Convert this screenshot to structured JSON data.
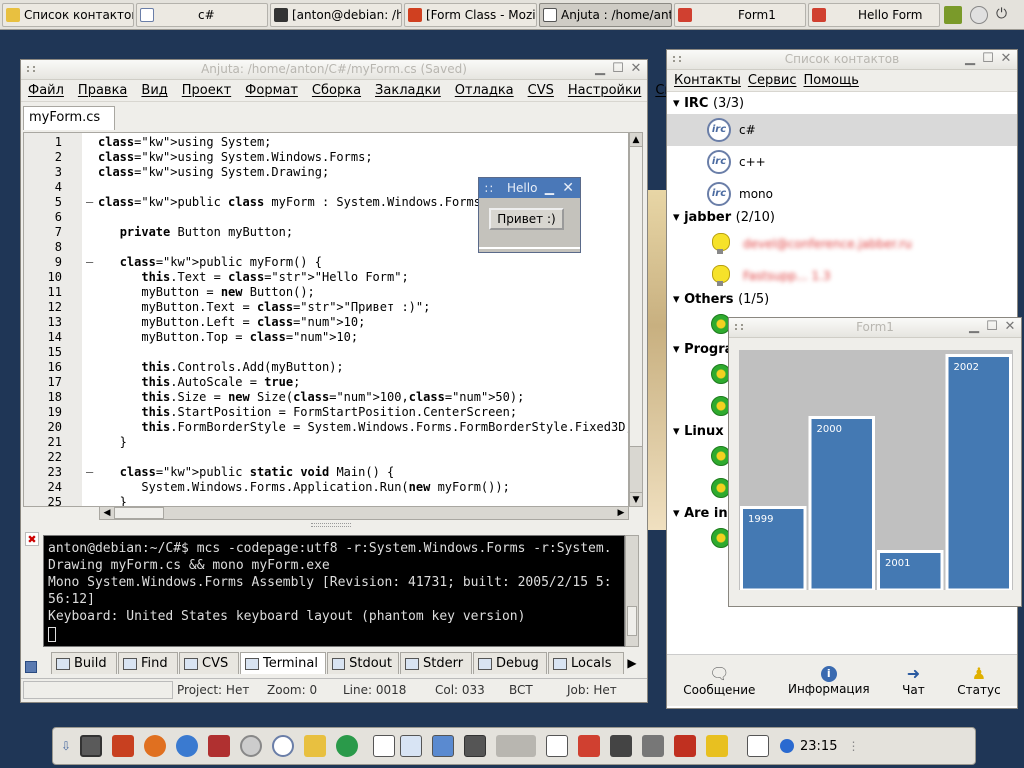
{
  "taskbar": {
    "tasks": [
      "Список контактов",
      "c#",
      "[anton@debian: /ho",
      "[Form Class - Mozil",
      "Anjuta : /home/ant",
      "Form1",
      "Hello Form"
    ]
  },
  "anjuta": {
    "title": "Anjuta: /home/anton/C#/myForm.cs (Saved)",
    "menu": [
      "Файл",
      "Правка",
      "Вид",
      "Проект",
      "Формат",
      "Сборка",
      "Закладки",
      "Отладка",
      "CVS",
      "Настройки",
      "Справка"
    ],
    "file_tab": "myForm.cs",
    "code_lines": [
      {
        "n": "1",
        "t": "using System;"
      },
      {
        "n": "2",
        "t": "using System.Windows.Forms;"
      },
      {
        "n": "3",
        "t": "using System.Drawing;"
      },
      {
        "n": "4",
        "t": ""
      },
      {
        "n": "5",
        "t": "public class myForm : System.Windows.Forms.Form {"
      },
      {
        "n": "6",
        "t": ""
      },
      {
        "n": "7",
        "t": "   private Button myButton;"
      },
      {
        "n": "8",
        "t": ""
      },
      {
        "n": "9",
        "t": "   public myForm() {"
      },
      {
        "n": "10",
        "t": "      this.Text = \"Hello Form\";"
      },
      {
        "n": "11",
        "t": "      myButton = new Button();"
      },
      {
        "n": "12",
        "t": "      myButton.Text = \"Привет :)\";"
      },
      {
        "n": "13",
        "t": "      myButton.Left = 10;"
      },
      {
        "n": "14",
        "t": "      myButton.Top = 10;"
      },
      {
        "n": "15",
        "t": ""
      },
      {
        "n": "16",
        "t": "      this.Controls.Add(myButton);"
      },
      {
        "n": "17",
        "t": "      this.AutoScale = true;"
      },
      {
        "n": "18",
        "t": "      this.Size = new Size(100,50);"
      },
      {
        "n": "19",
        "t": "      this.StartPosition = FormStartPosition.CenterScreen;"
      },
      {
        "n": "20",
        "t": "      this.FormBorderStyle = System.Windows.Forms.FormBorderStyle.Fixed3D;"
      },
      {
        "n": "21",
        "t": "   }"
      },
      {
        "n": "22",
        "t": ""
      },
      {
        "n": "23",
        "t": "   public static void Main() {"
      },
      {
        "n": "24",
        "t": "      System.Windows.Forms.Application.Run(new myForm());"
      },
      {
        "n": "25",
        "t": "   }"
      }
    ],
    "terminal_lines": [
      "anton@debian:~/C#$ mcs -codepage:utf8 -r:System.Windows.Forms -r:System.",
      "Drawing myForm.cs && mono myForm.exe",
      "Mono System.Windows.Forms Assembly [Revision: 41731; built: 2005/2/15 5:",
      "56:12]",
      "Keyboard: United States keyboard layout (phantom key version)"
    ],
    "bottom_tabs": [
      "Build",
      "Find",
      "CVS",
      "Terminal",
      "Stdout",
      "Stderr",
      "Debug",
      "Locals"
    ],
    "status": {
      "project": "Project: Нет",
      "zoom": "Zoom: 0",
      "line": "Line: 0018",
      "col": "Col: 033",
      "mode": "BCT",
      "job": "Job: Нет"
    }
  },
  "hello_form": {
    "title": "Hello",
    "button": "Привет :)"
  },
  "contacts": {
    "title": "Список контактов",
    "menu": [
      "Контакты",
      "Сервис",
      "Помощь"
    ],
    "groups": [
      {
        "name": "IRC",
        "count": "(3/3)",
        "items": [
          "c#",
          "c++",
          "mono"
        ]
      },
      {
        "name": "jabber",
        "count": "(2/10)",
        "items": [
          "devel@conference.jabber.ru",
          "Fastsupp... 1.3"
        ]
      },
      {
        "name": "Others",
        "count": "(1/5)"
      },
      {
        "name": "Progra"
      },
      {
        "name": "Linux"
      },
      {
        "name": "Are in"
      }
    ],
    "bottom_buttons": [
      "Сообщение",
      "Информация",
      "Чат",
      "Статус"
    ]
  },
  "form1": {
    "title": "Form1"
  },
  "chart_data": {
    "type": "bar",
    "categories": [
      "1999",
      "2000",
      "2001",
      "2002"
    ],
    "values": [
      42,
      87,
      20,
      118
    ],
    "ylim": [
      0,
      120
    ],
    "colors": {
      "bar": "#4479b3",
      "edge": "#ffffff",
      "bg": "#c0c0c0"
    },
    "title": "",
    "xlabel": "",
    "ylabel": ""
  },
  "clock": "23:15"
}
